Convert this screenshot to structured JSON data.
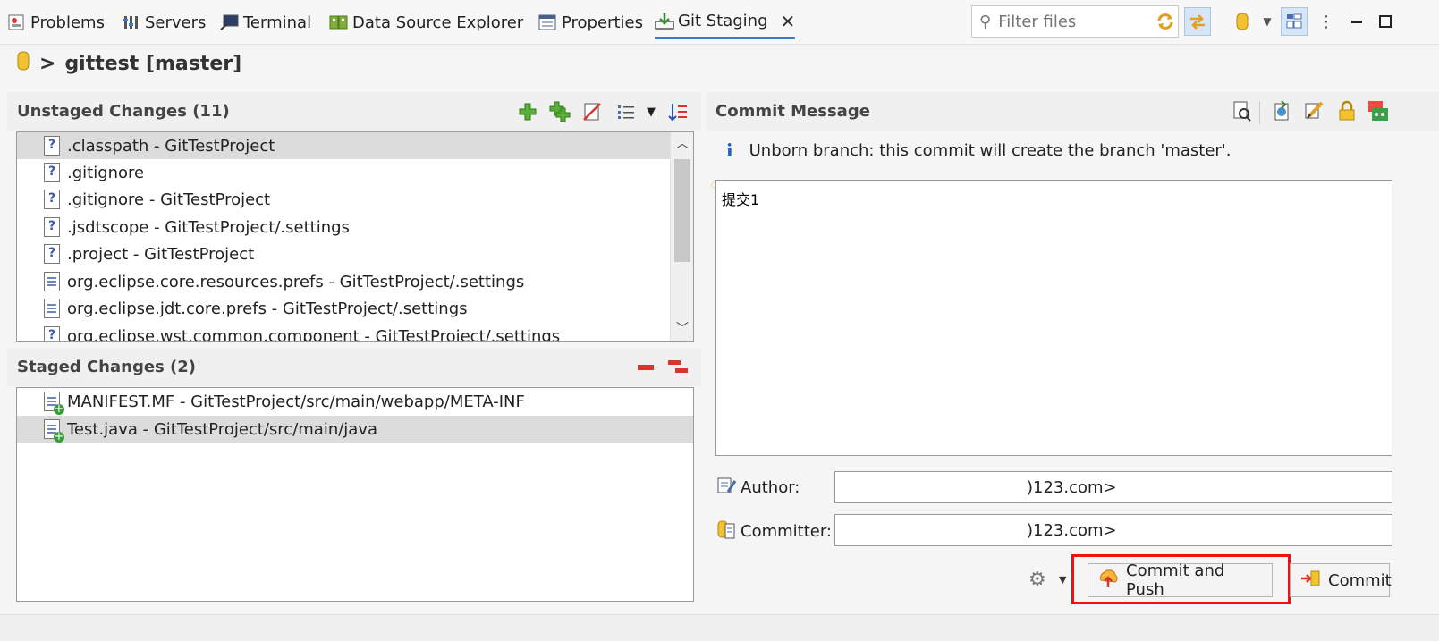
{
  "tabs": [
    {
      "label": "Problems",
      "icon": "problems-icon"
    },
    {
      "label": "Servers",
      "icon": "servers-icon"
    },
    {
      "label": "Terminal",
      "icon": "terminal-icon"
    },
    {
      "label": "Data Source Explorer",
      "icon": "database-explorer-icon"
    },
    {
      "label": "Properties",
      "icon": "properties-icon"
    },
    {
      "label": "Git Staging",
      "icon": "git-staging-icon",
      "active": true
    }
  ],
  "filter": {
    "placeholder": "Filter files"
  },
  "repo": {
    "title": "gittest [master]",
    "separator": ">"
  },
  "unstaged": {
    "title": "Unstaged Changes (11)",
    "items": [
      {
        "label": ".classpath - GitTestProject",
        "type": "unknown",
        "selected": true
      },
      {
        "label": ".gitignore",
        "type": "unknown"
      },
      {
        "label": ".gitignore - GitTestProject",
        "type": "unknown"
      },
      {
        "label": ".jsdtscope - GitTestProject/.settings",
        "type": "unknown"
      },
      {
        "label": ".project - GitTestProject",
        "type": "unknown"
      },
      {
        "label": "org.eclipse.core.resources.prefs - GitTestProject/.settings",
        "type": "text"
      },
      {
        "label": "org.eclipse.jdt.core.prefs - GitTestProject/.settings",
        "type": "text"
      },
      {
        "label": "org.eclipse.wst.common.component - GitTestProject/.settings",
        "type": "unknown"
      }
    ]
  },
  "staged": {
    "title": "Staged Changes (2)",
    "items": [
      {
        "label": "MANIFEST.MF - GitTestProject/src/main/webapp/META-INF",
        "type": "added"
      },
      {
        "label": "Test.java - GitTestProject/src/main/java",
        "type": "added",
        "selected": true
      }
    ]
  },
  "commit": {
    "title": "Commit Message",
    "info": "Unborn branch: this commit will create the branch 'master'.",
    "message": "提交1",
    "author_label": "Author:",
    "author_value": ")123.com>",
    "committer_label": "Committer:",
    "committer_value": ")123.com>",
    "commit_push_label": "Commit and Push",
    "commit_label": "Commit"
  },
  "colors": {
    "accent": "#3f78c8",
    "highlight": "#e11111",
    "add_green": "#3a9a3a",
    "remove_red": "#d9342b"
  }
}
